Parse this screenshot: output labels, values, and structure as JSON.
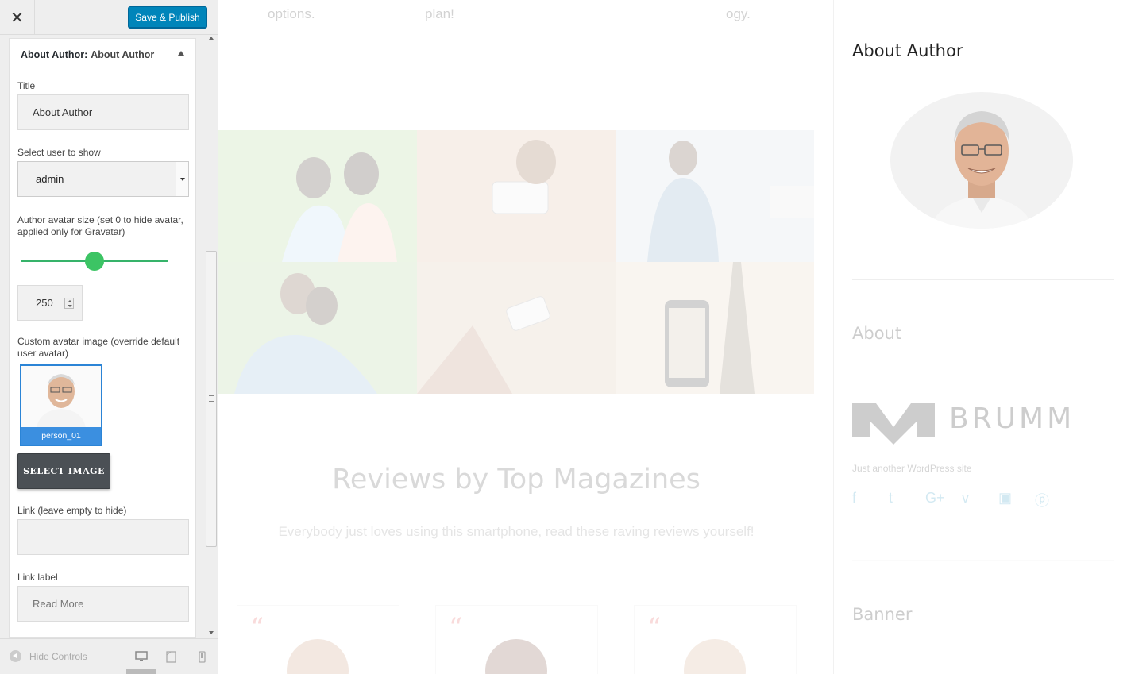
{
  "panel": {
    "close_label": "✕",
    "save_label": "Save & Publish",
    "widget": {
      "prefix": "About Author:",
      "name": "About Author"
    },
    "fields": {
      "title_label": "Title",
      "title_value": "About Author",
      "user_label": "Select user to show",
      "user_value": "admin",
      "avatar_size_label_1": "Author avatar size (set 0 to hide avatar,",
      "avatar_size_label_2": "applied only for Gravatar)",
      "avatar_size_value": "250",
      "avatar_size_slider_fraction": 0.5,
      "custom_avatar_label_1": "Custom avatar image (override default",
      "custom_avatar_label_2": "user avatar)",
      "avatar_caption": "person_01",
      "select_image_label": "SELECT IMAGE",
      "link_label": "Link (leave empty to hide)",
      "link_value": "",
      "link_label_label": "Link label",
      "link_label_placeholder": "Read More"
    },
    "footer": {
      "hide_controls": "Hide Controls"
    }
  },
  "preview": {
    "top_words": [
      "options.",
      "plan!",
      "ogy."
    ],
    "reviews_title": "Reviews by Top Magazines",
    "reviews_subtitle": "Everybody just loves using this smartphone, read these raving reviews yourself!",
    "quote_mark": "“",
    "sidebar": {
      "about_author_title": "About Author",
      "about_title": "About",
      "brand": "BRUMM",
      "tagline": "Just another WordPress site",
      "banner_title": "Banner",
      "social_icons": [
        "facebook-icon",
        "twitter-icon",
        "google-plus-icon",
        "vimeo-icon",
        "youtube-icon",
        "pinterest-icon"
      ]
    }
  },
  "colors": {
    "primary_button": "#0085ba",
    "slider": "#3cc464",
    "selection": "#2b84d6"
  }
}
